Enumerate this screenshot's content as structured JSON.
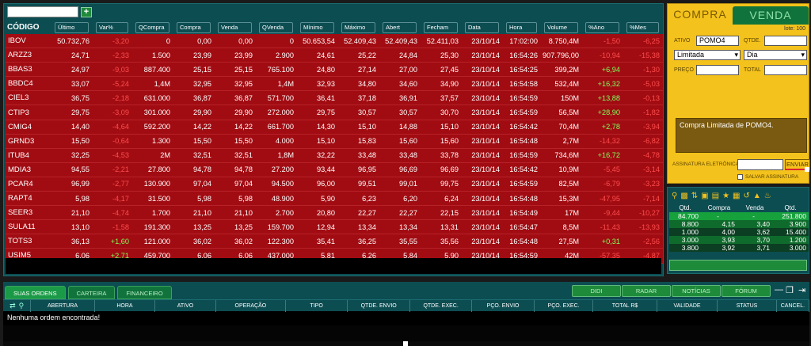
{
  "quotes": {
    "columns": [
      "CÓDIGO",
      "Último",
      "Var%",
      "QCompra",
      "Compra",
      "Venda",
      "QVenda",
      "Mínimo",
      "Máximo",
      "Abert",
      "Fecham",
      "Data",
      "Hora",
      "Volume",
      "%Ano",
      "%Mes"
    ],
    "rows": [
      [
        "IBOV",
        "50.732,76",
        "-3,20",
        "0",
        "0,00",
        "0,00",
        "0",
        "50.653,54",
        "52.409,43",
        "52.409,43",
        "52.411,03",
        "23/10/14",
        "17:02:00",
        "8.750,4M",
        "-1,50",
        "-6,25"
      ],
      [
        "ARZZ3",
        "24,71",
        "-2,33",
        "1.500",
        "23,99",
        "23,99",
        "2.900",
        "24,61",
        "25,22",
        "24,84",
        "25,30",
        "23/10/14",
        "16:54:26",
        "907.796,00",
        "-10,94",
        "-15,38"
      ],
      [
        "BBAS3",
        "24,97",
        "-9,03",
        "887.400",
        "25,15",
        "25,15",
        "765.100",
        "24,80",
        "27,14",
        "27,00",
        "27,45",
        "23/10/14",
        "16:54:25",
        "399,2M",
        "+6,94",
        "-1,30"
      ],
      [
        "BBDC4",
        "33,07",
        "-5,24",
        "1,4M",
        "32,95",
        "32,95",
        "1,4M",
        "32,93",
        "34,80",
        "34,60",
        "34,90",
        "23/10/14",
        "16:54:58",
        "532,4M",
        "+16,32",
        "-5,03"
      ],
      [
        "CIEL3",
        "36,75",
        "-2,18",
        "631.000",
        "36,87",
        "36,87",
        "571.700",
        "36,41",
        "37,18",
        "36,91",
        "37,57",
        "23/10/14",
        "16:54:59",
        "150M",
        "+13,88",
        "-0,13"
      ],
      [
        "CTIP3",
        "29,75",
        "-3,09",
        "301.000",
        "29,90",
        "29,90",
        "272.000",
        "29,75",
        "30,57",
        "30,57",
        "30,70",
        "23/10/14",
        "16:54:59",
        "56,5M",
        "+28,90",
        "-1,82"
      ],
      [
        "CMIG4",
        "14,40",
        "-4,64",
        "592.200",
        "14,22",
        "14,22",
        "661.700",
        "14,30",
        "15,10",
        "14,88",
        "15,10",
        "23/10/14",
        "16:54:42",
        "70,4M",
        "+2,78",
        "-3,94"
      ],
      [
        "GRND3",
        "15,50",
        "-0,64",
        "1.300",
        "15,50",
        "15,50",
        "4.000",
        "15,10",
        "15,83",
        "15,60",
        "15,60",
        "23/10/14",
        "16:54:48",
        "2,7M",
        "-14,32",
        "-6,82"
      ],
      [
        "ITUB4",
        "32,25",
        "-4,53",
        "2M",
        "32,51",
        "32,51",
        "1,8M",
        "32,22",
        "33,48",
        "33,48",
        "33,78",
        "23/10/14",
        "16:54:59",
        "734,6M",
        "+16,72",
        "-4,78"
      ],
      [
        "MDIA3",
        "94,55",
        "-2,21",
        "27.800",
        "94,78",
        "94,78",
        "27.200",
        "93,44",
        "96,95",
        "96,69",
        "96,69",
        "23/10/14",
        "16:54:42",
        "10,9M",
        "-5,45",
        "-3,14"
      ],
      [
        "PCAR4",
        "96,99",
        "-2,77",
        "130.900",
        "97,04",
        "97,04",
        "94.500",
        "96,00",
        "99,51",
        "99,01",
        "99,75",
        "23/10/14",
        "16:54:59",
        "82,5M",
        "-6,79",
        "-3,23"
      ],
      [
        "RAPT4",
        "5,98",
        "-4,17",
        "31.500",
        "5,98",
        "5,98",
        "48.900",
        "5,90",
        "6,23",
        "6,20",
        "6,24",
        "23/10/14",
        "16:54:48",
        "15,3M",
        "-47,95",
        "-7,14"
      ],
      [
        "SEER3",
        "21,10",
        "-4,74",
        "1.700",
        "21,10",
        "21,10",
        "2.700",
        "20,80",
        "22,27",
        "22,27",
        "22,15",
        "23/10/14",
        "16:54:49",
        "17M",
        "-9,44",
        "-10,27"
      ],
      [
        "SULA11",
        "13,10",
        "-1,58",
        "191.300",
        "13,25",
        "13,25",
        "159.700",
        "12,94",
        "13,34",
        "13,34",
        "13,31",
        "23/10/14",
        "16:54:47",
        "8,5M",
        "-11,43",
        "-13,93"
      ],
      [
        "TOTS3",
        "36,13",
        "+1,60",
        "121.000",
        "36,02",
        "36,02",
        "122.300",
        "35,41",
        "36,25",
        "35,55",
        "35,56",
        "23/10/14",
        "16:54:48",
        "27,5M",
        "+0,31",
        "-2,56"
      ],
      [
        "USIM5",
        "6,06",
        "+2,71",
        "459.700",
        "6,06",
        "6,06",
        "437.000",
        "5,81",
        "6,26",
        "5,84",
        "5,90",
        "23/10/14",
        "16:54:59",
        "42M",
        "-57,35",
        "-4,87"
      ]
    ],
    "colors": {
      "row_bg": "#a10c12",
      "negative": "#ff4d4d",
      "positive": "#7cff5c"
    }
  },
  "order": {
    "tab_buy": "COMPRA",
    "tab_sell": "VENDA",
    "lote": "lote: 100",
    "ativo_label": "ATIVO",
    "ativo_value": "POMO4",
    "qtde_label": "QTDE.",
    "type_value": "Limitada",
    "validity_value": "Dia",
    "preco_label": "PREÇO",
    "total_label": "TOTAL",
    "message": "Compra Limitada de POMO4.",
    "signature_label": "ASSINATURA ELETRÔNICA:",
    "send_label": "ENVIAR",
    "save_signature_label": "SALVAR ASSINATURA"
  },
  "book": {
    "columns": [
      "Qtd.",
      "Compra",
      "Venda",
      "Qtd."
    ],
    "rows": [
      [
        "84.700",
        "-",
        "-",
        "251.800"
      ],
      [
        "8.800",
        "4,15",
        "3,40",
        "3.900"
      ],
      [
        "1.000",
        "4,00",
        "3,62",
        "15.400"
      ],
      [
        "3.000",
        "3,93",
        "3,70",
        "1.200"
      ],
      [
        "3.800",
        "3,92",
        "3,71",
        "3.000"
      ]
    ]
  },
  "orders": {
    "tabs": [
      "SUAS ORDENS",
      "CARTEIRA",
      "FINANCEIRO"
    ],
    "right_buttons": [
      "DIDI",
      "RADAR",
      "NOTÍCIAS",
      "FÓRUM"
    ],
    "columns": [
      "ABERTURA",
      "HORA",
      "ATIVO",
      "OPERAÇÃO",
      "TIPO",
      "QTDE. ENVIO",
      "QTDE. EXEC.",
      "PÇO. ENVIO",
      "PÇO. EXEC.",
      "TOTAL R$",
      "VALIDADE",
      "STATUS",
      "CANCEL."
    ],
    "empty_message": "Nenhuma ordem encontrada!"
  }
}
